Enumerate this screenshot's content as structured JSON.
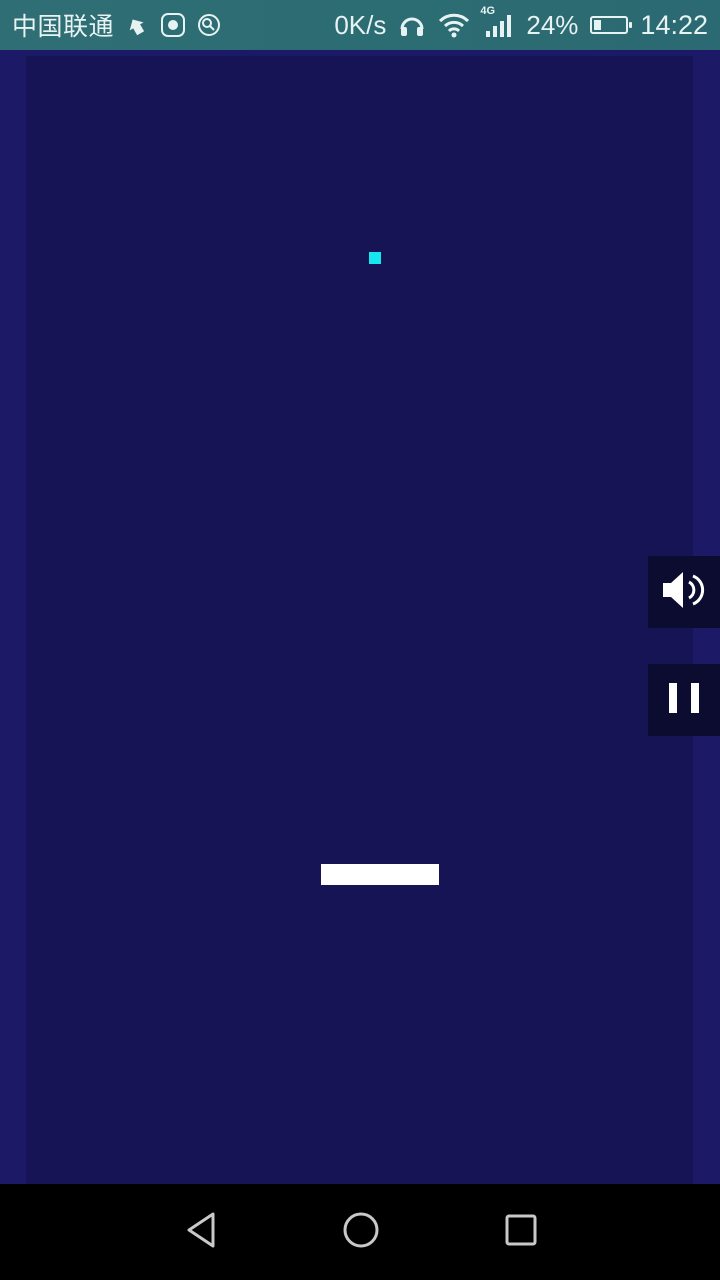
{
  "status_bar": {
    "carrier": "中国联通",
    "net_speed": "0K/s",
    "network_type": "4G",
    "battery_percent": "24%",
    "battery_level": 0.24,
    "time": "14:22",
    "icons": [
      "pin-icon",
      "huawei-app-icon",
      "location-icon",
      "headphones-icon",
      "wifi-icon",
      "cell-signal-icon",
      "battery-icon"
    ]
  },
  "game": {
    "ball_color": "#16e6ee",
    "paddle_color": "#ffffff",
    "background_color": "#161454",
    "border_color": "#1c1a66"
  },
  "controls": {
    "sound_icon": "speaker-icon",
    "pause_icon": "pause-icon"
  },
  "nav_bar": {
    "icons": [
      "back-icon",
      "home-icon",
      "recents-icon"
    ]
  }
}
